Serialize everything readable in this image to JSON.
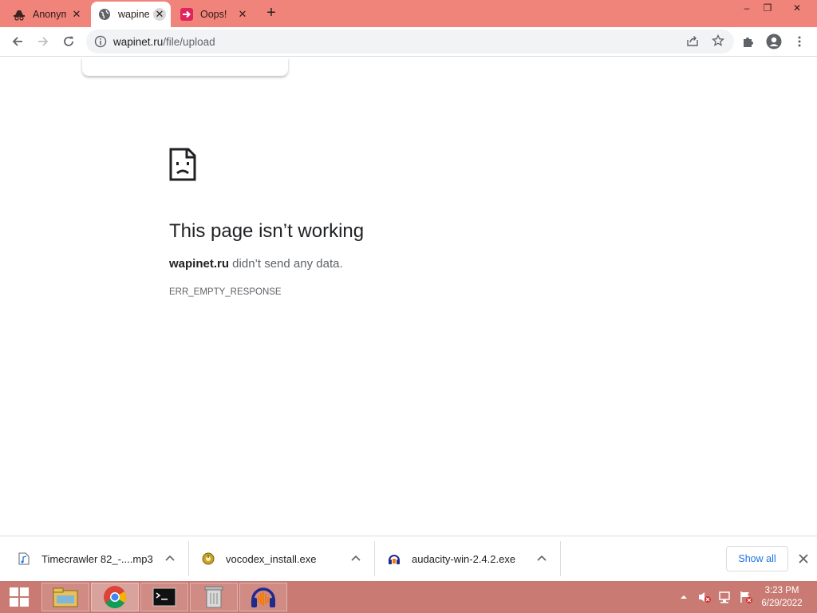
{
  "tabs": [
    {
      "title": "Anonym",
      "icon": "hat-glasses-icon",
      "active": false
    },
    {
      "title": "wapine",
      "icon": "globe-icon",
      "active": true
    },
    {
      "title": "Oops! I",
      "icon": "arrow-right-pink-icon",
      "active": false
    }
  ],
  "window_controls": {
    "minimize": "–",
    "restore": "❐",
    "close": "✕"
  },
  "address_bar": {
    "domain": "wapinet.ru",
    "path": "/file/upload"
  },
  "error": {
    "title": "This page isn’t working",
    "host": "wapinet.ru",
    "message": " didn’t send any data.",
    "code": "ERR_EMPTY_RESPONSE"
  },
  "downloads": [
    {
      "name": "Timecrawler 82_-....mp3",
      "icon": "audio-file-icon"
    },
    {
      "name": "vocodex_install.exe",
      "icon": "installer-icon"
    },
    {
      "name": "audacity-win-2.4.2.exe",
      "icon": "audacity-icon"
    }
  ],
  "shelf": {
    "show_all": "Show all"
  },
  "taskbar": {
    "apps": [
      "file-explorer-icon",
      "chrome-icon",
      "cmd-icon",
      "recycle-app-icon",
      "audacity-icon"
    ],
    "clock_time": "3:23 PM",
    "clock_date": "6/29/2022"
  },
  "colors": {
    "tabbar": "#f1847a",
    "taskbar": "#c97b73",
    "link_blue": "#1a73e8"
  }
}
